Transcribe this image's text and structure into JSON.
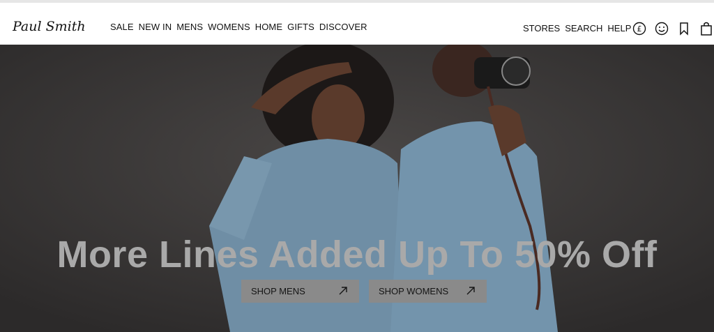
{
  "brand": {
    "logo_text": "Paul Smith"
  },
  "nav": {
    "primary": [
      "SALE",
      "NEW IN",
      "MENS",
      "WOMENS",
      "HOME",
      "GIFTS",
      "DISCOVER"
    ],
    "secondary": [
      "STORES",
      "SEARCH",
      "HELP"
    ]
  },
  "icons": [
    "currency-pound-icon",
    "account-smile-icon",
    "bookmark-icon",
    "bag-icon"
  ],
  "hero": {
    "headline": "More Lines Added Up To 50% Off",
    "cta_mens": "SHOP MENS",
    "cta_womens": "SHOP WOMENS"
  },
  "colors": {
    "header_bg": "#ffffff",
    "hero_bg": "#3a3838",
    "cta_bg": "#8a8a8a",
    "headline": "#a9a9a9"
  }
}
